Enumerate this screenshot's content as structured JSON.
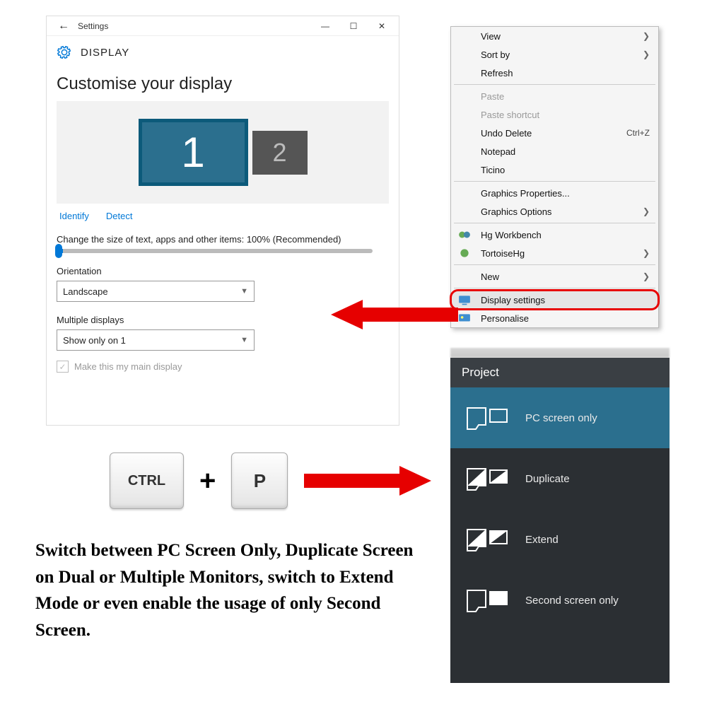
{
  "settings": {
    "window_title": "Settings",
    "header": "DISPLAY",
    "heading": "Customise your display",
    "monitor1": "1",
    "monitor2": "2",
    "identify": "Identify",
    "detect": "Detect",
    "size_label": "Change the size of text, apps and other items: 100% (Recommended)",
    "orientation_label": "Orientation",
    "orientation_value": "Landscape",
    "multi_label": "Multiple displays",
    "multi_value": "Show only on 1",
    "main_display": "Make this my main display"
  },
  "context_menu": {
    "view": "View",
    "sort": "Sort by",
    "refresh": "Refresh",
    "paste": "Paste",
    "paste_shortcut": "Paste shortcut",
    "undo": "Undo Delete",
    "undo_key": "Ctrl+Z",
    "notepad": "Notepad",
    "ticino": "Ticino",
    "gfx_props": "Graphics Properties...",
    "gfx_opts": "Graphics Options",
    "hg": "Hg Workbench",
    "tortoise": "TortoiseHg",
    "new": "New",
    "display": "Display settings",
    "personalise": "Personalise"
  },
  "keys": {
    "ctrl": "CTRL",
    "plus": "+",
    "p": "P"
  },
  "caption": "Switch between PC Screen Only, Duplicate Screen on Dual or Multiple Monitors, switch to Extend Mode or even enable the usage of only Second Screen.",
  "project": {
    "title": "Project",
    "pc_only": "PC screen only",
    "duplicate": "Duplicate",
    "extend": "Extend",
    "second_only": "Second screen only"
  }
}
